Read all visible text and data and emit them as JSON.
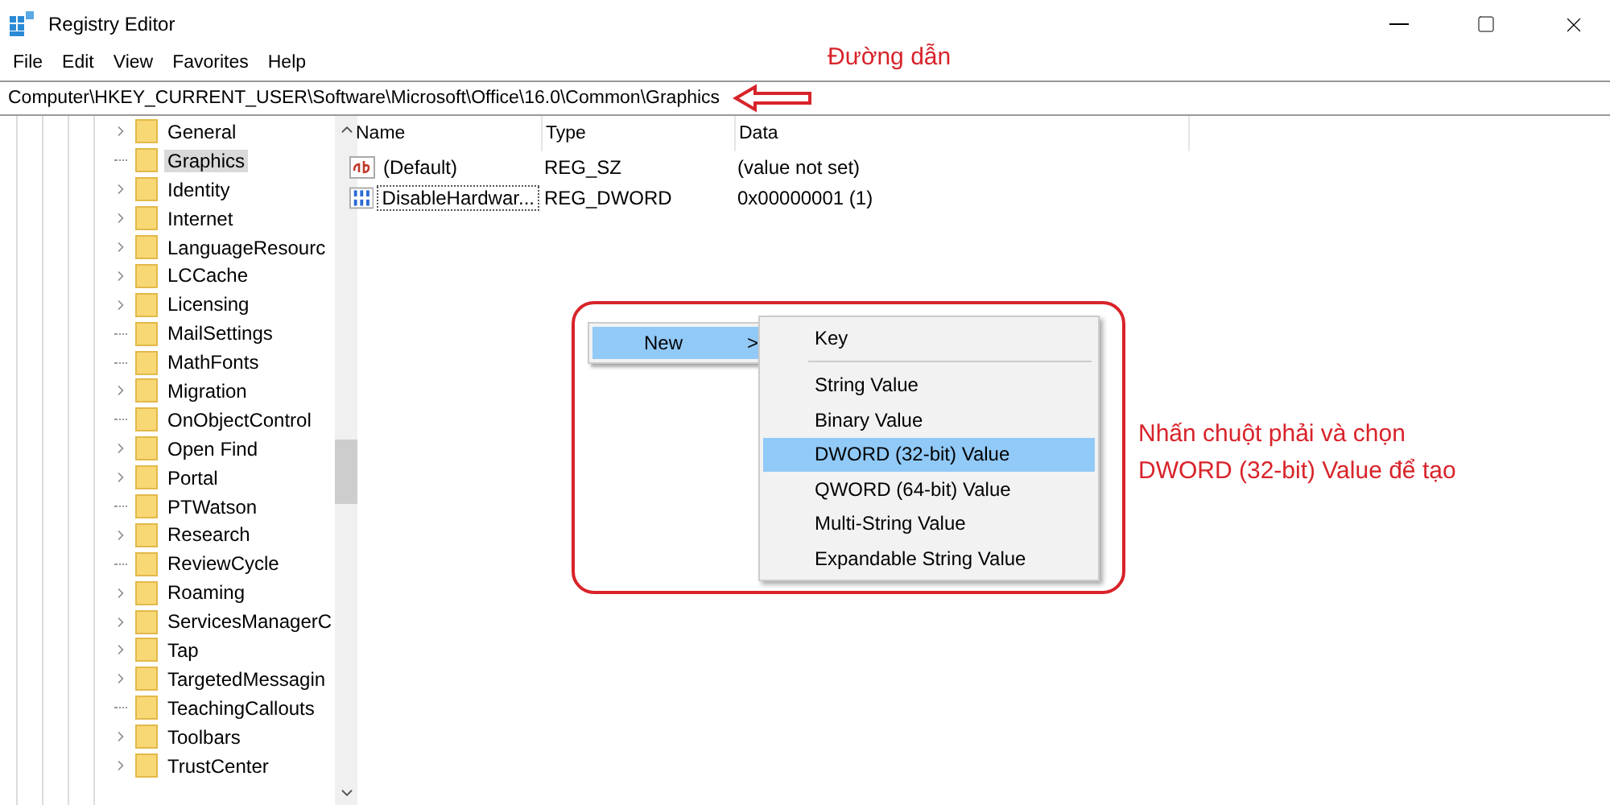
{
  "window": {
    "title": "Registry Editor"
  },
  "menu": [
    "File",
    "Edit",
    "View",
    "Favorites",
    "Help"
  ],
  "address": "Computer\\HKEY_CURRENT_USER\\Software\\Microsoft\\Office\\16.0\\Common\\Graphics",
  "tree": [
    {
      "label": "General",
      "expandable": true,
      "selected": false
    },
    {
      "label": "Graphics",
      "expandable": false,
      "selected": true
    },
    {
      "label": "Identity",
      "expandable": true,
      "selected": false
    },
    {
      "label": "Internet",
      "expandable": true,
      "selected": false
    },
    {
      "label": "LanguageResourc",
      "expandable": true,
      "selected": false
    },
    {
      "label": "LCCache",
      "expandable": true,
      "selected": false
    },
    {
      "label": "Licensing",
      "expandable": true,
      "selected": false
    },
    {
      "label": "MailSettings",
      "expandable": false,
      "selected": false
    },
    {
      "label": "MathFonts",
      "expandable": false,
      "selected": false
    },
    {
      "label": "Migration",
      "expandable": true,
      "selected": false
    },
    {
      "label": "OnObjectControl",
      "expandable": false,
      "selected": false
    },
    {
      "label": "Open Find",
      "expandable": true,
      "selected": false
    },
    {
      "label": "Portal",
      "expandable": true,
      "selected": false
    },
    {
      "label": "PTWatson",
      "expandable": false,
      "selected": false
    },
    {
      "label": "Research",
      "expandable": true,
      "selected": false
    },
    {
      "label": "ReviewCycle",
      "expandable": false,
      "selected": false
    },
    {
      "label": "Roaming",
      "expandable": true,
      "selected": false
    },
    {
      "label": "ServicesManagerC",
      "expandable": true,
      "selected": false
    },
    {
      "label": "Tap",
      "expandable": true,
      "selected": false
    },
    {
      "label": "TargetedMessagin",
      "expandable": true,
      "selected": false
    },
    {
      "label": "TeachingCallouts",
      "expandable": false,
      "selected": false
    },
    {
      "label": "Toolbars",
      "expandable": true,
      "selected": false
    },
    {
      "label": "TrustCenter",
      "expandable": true,
      "selected": false
    }
  ],
  "table": {
    "columns": [
      "Name",
      "Type",
      "Data"
    ],
    "rows": [
      {
        "kind": "string",
        "name": "(Default)",
        "type": "REG_SZ",
        "data": "(value not set)",
        "focused": false
      },
      {
        "kind": "binary",
        "name": "DisableHardwar...",
        "type": "REG_DWORD",
        "data": "0x00000001 (1)",
        "focused": true
      }
    ]
  },
  "context_menu": {
    "label": "New",
    "arrow": ">",
    "selected": true
  },
  "submenu": [
    {
      "label": "Key",
      "selected": false,
      "separator_after": true
    },
    {
      "label": "String Value",
      "selected": false,
      "separator_after": false
    },
    {
      "label": "Binary Value",
      "selected": false,
      "separator_after": false
    },
    {
      "label": "DWORD (32-bit) Value",
      "selected": true,
      "separator_after": false
    },
    {
      "label": "QWORD (64-bit) Value",
      "selected": false,
      "separator_after": false
    },
    {
      "label": "Multi-String Value",
      "selected": false,
      "separator_after": false
    },
    {
      "label": "Expandable String Value",
      "selected": false,
      "separator_after": false
    }
  ],
  "annotations": {
    "path_label": "Đường dẫn",
    "instruction": [
      "Nhấn chuột phải và chọn",
      "DWORD (32-bit) Value để tạo"
    ]
  }
}
